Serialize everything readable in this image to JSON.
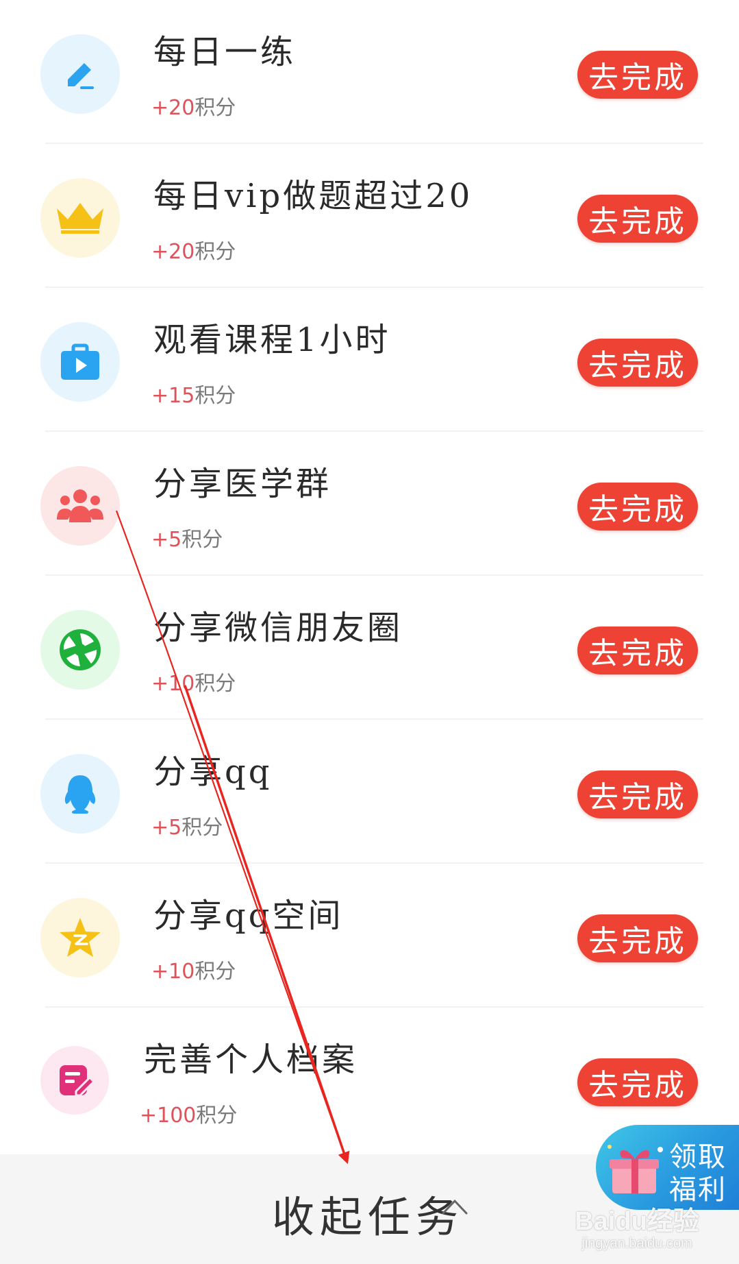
{
  "tasks": [
    {
      "title": "每日一练",
      "points_plus": "+20",
      "points_unit": "积分",
      "button": "去完成",
      "icon": "edit-pencil-icon",
      "icon_bg": "#e5f4fd",
      "icon_color": "#2aa3f0"
    },
    {
      "title": "每日vip做题超过20",
      "points_plus": "+20",
      "points_unit": "积分",
      "button": "去完成",
      "icon": "crown-icon",
      "icon_bg": "#fdf6dc",
      "icon_color": "#f5c116"
    },
    {
      "title": "观看课程1小时",
      "points_plus": "+15",
      "points_unit": "积分",
      "button": "去完成",
      "icon": "video-briefcase-icon",
      "icon_bg": "#e5f4fd",
      "icon_color": "#2aa3f0"
    },
    {
      "title": "分享医学群",
      "points_plus": "+5",
      "points_unit": "积分",
      "button": "去完成",
      "icon": "group-people-icon",
      "icon_bg": "#fde6e6",
      "icon_color": "#f0585a"
    },
    {
      "title": "分享微信朋友圈",
      "points_plus": "+10",
      "points_unit": "积分",
      "button": "去完成",
      "icon": "wechat-moments-icon",
      "icon_bg": "#e3fae6",
      "icon_color": "#1fb13c"
    },
    {
      "title": "分享qq",
      "points_plus": "+5",
      "points_unit": "积分",
      "button": "去完成",
      "icon": "qq-penguin-icon",
      "icon_bg": "#e5f4fd",
      "icon_color": "#2aa3f0"
    },
    {
      "title": "分享qq空间",
      "points_plus": "+10",
      "points_unit": "积分",
      "button": "去完成",
      "icon": "qzone-star-icon",
      "icon_bg": "#fdf6dc",
      "icon_color": "#f5c116"
    },
    {
      "title": "完善个人档案",
      "points_plus": "+100",
      "points_unit": "积分",
      "button": "去完成",
      "icon": "profile-edit-icon",
      "icon_bg": "#fde8f1",
      "icon_color": "#e0307a"
    }
  ],
  "footer": {
    "collapse_label": "收起任务",
    "chevron_icon": "chevron-up-icon"
  },
  "welfare": {
    "line1": "领取",
    "line2": "福利",
    "icon": "gift-box-icon"
  },
  "watermark": {
    "main": "Baidu经验",
    "sub": "jingyan.baidu.com"
  },
  "colors": {
    "button": "#ee4234",
    "annotation_arrow": "#e8251f",
    "points_plus": "#e0525a"
  }
}
